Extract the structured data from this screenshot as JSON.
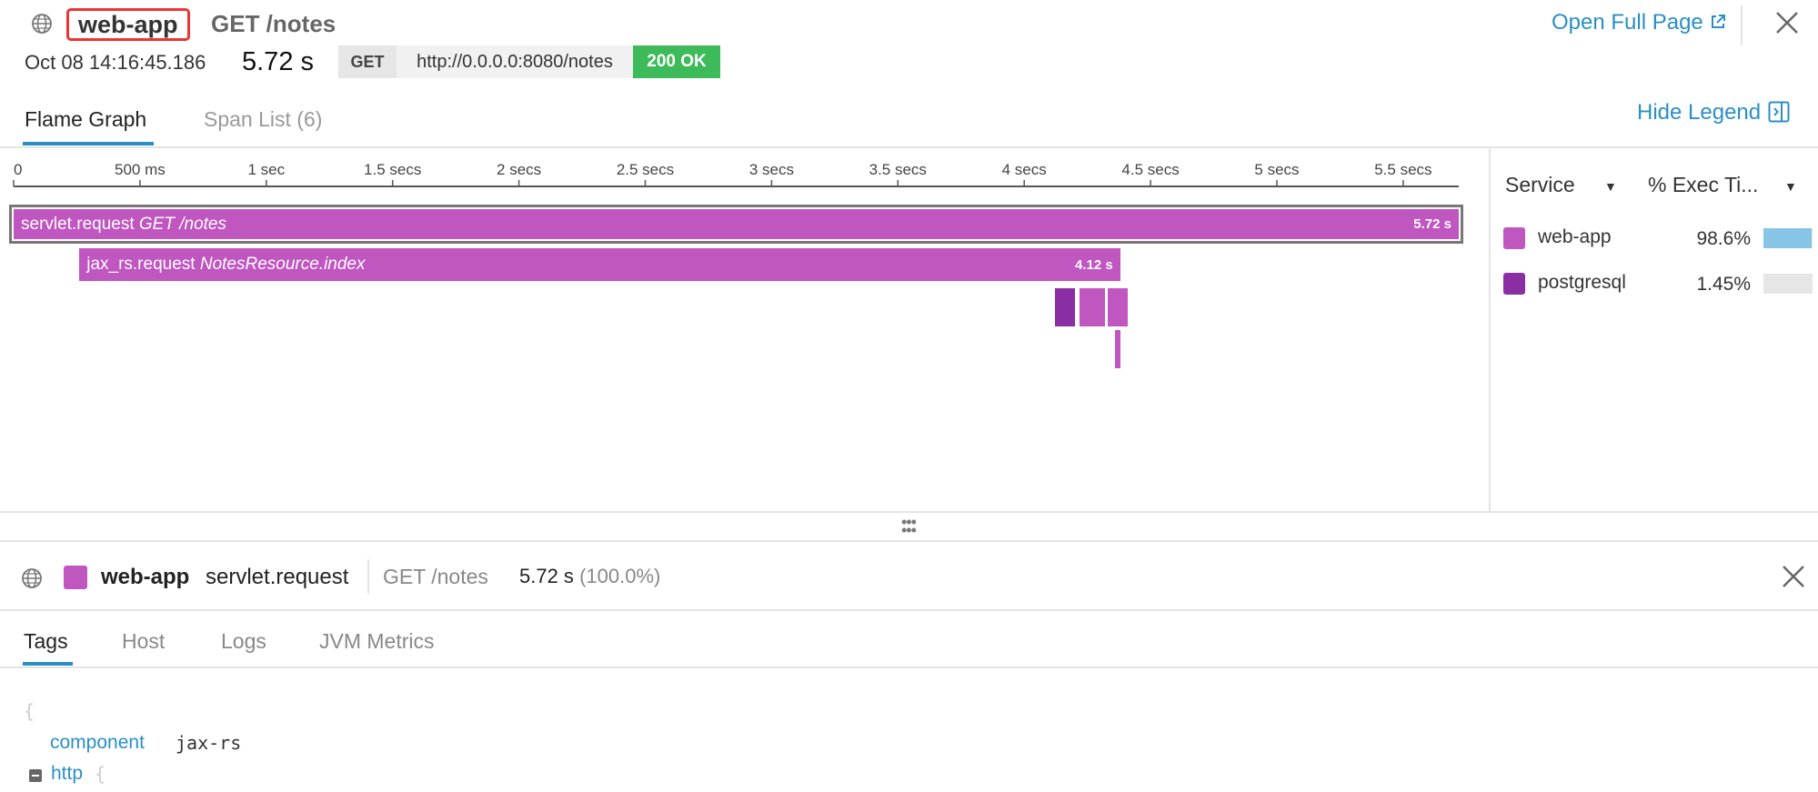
{
  "header": {
    "service": "web-app",
    "resource": "GET /notes",
    "open_full_page": "Open Full Page",
    "timestamp": "Oct 08 14:16:45.186",
    "duration": "5.72 s",
    "method": "GET",
    "url": "http://0.0.0.0:8080/notes",
    "status": "200 OK"
  },
  "tabs": {
    "flame_graph": "Flame Graph",
    "span_list": "Span List (6)",
    "hide_legend": "Hide Legend"
  },
  "axis": {
    "ticks": [
      "0",
      "500 ms",
      "1 sec",
      "1.5 secs",
      "2 secs",
      "2.5 secs",
      "3 secs",
      "3.5 secs",
      "4 secs",
      "4.5 secs",
      "5 secs",
      "5.5 secs"
    ],
    "tick_values_s": [
      0,
      0.5,
      1,
      1.5,
      2,
      2.5,
      3,
      3.5,
      4,
      4.5,
      5,
      5.5
    ],
    "max_s": 5.72
  },
  "spans": [
    {
      "operation": "servlet.request",
      "resource": "GET /notes",
      "duration_label": "5.72 s",
      "start_s": 0,
      "duration_s": 5.72,
      "depth": 0,
      "service": "web-app",
      "selected": true
    },
    {
      "operation": "jax_rs.request",
      "resource": "NotesResource.index",
      "duration_label": "4.12 s",
      "start_s": 0.26,
      "duration_s": 4.12,
      "depth": 1,
      "service": "web-app",
      "selected": false
    },
    {
      "operation": "",
      "resource": "",
      "duration_label": "",
      "start_s": 4.12,
      "duration_s": 0.08,
      "depth": 2,
      "service": "postgresql",
      "selected": false
    },
    {
      "operation": "",
      "resource": "",
      "duration_label": "",
      "start_s": 4.22,
      "duration_s": 0.1,
      "depth": 2,
      "service": "web-app",
      "selected": false
    },
    {
      "operation": "",
      "resource": "",
      "duration_label": "",
      "start_s": 4.33,
      "duration_s": 0.08,
      "depth": 2,
      "service": "web-app",
      "selected": false
    },
    {
      "operation": "",
      "resource": "",
      "duration_label": "",
      "start_s": 4.36,
      "duration_s": 0.02,
      "depth": 3,
      "service": "web-app",
      "selected": false
    }
  ],
  "legend": {
    "col_service": "Service",
    "col_exec": "% Exec Ti...",
    "items": [
      {
        "name": "web-app",
        "pct": "98.6%",
        "pct_value": 98.6,
        "color": "#c056c0",
        "bar_color": "#88c4e6"
      },
      {
        "name": "postgresql",
        "pct": "1.45%",
        "pct_value": 1.45,
        "color": "#8a2fa3",
        "bar_color": "#88c4e6"
      }
    ]
  },
  "colors": {
    "web-app": "#c056c0",
    "postgresql": "#8a2fa3",
    "accent": "#2b8fc5",
    "status_ok": "#3dbb5a"
  },
  "detail": {
    "service": "web-app",
    "operation": "servlet.request",
    "resource": "GET /notes",
    "duration": "5.72 s",
    "percent": "(100.0%)",
    "tabs": [
      "Tags",
      "Host",
      "Logs",
      "JVM Metrics"
    ],
    "tags": {
      "open_brace": "{",
      "component_key": "component",
      "component_val": "jax-rs",
      "http_key": "http",
      "http_brace": "{"
    }
  }
}
